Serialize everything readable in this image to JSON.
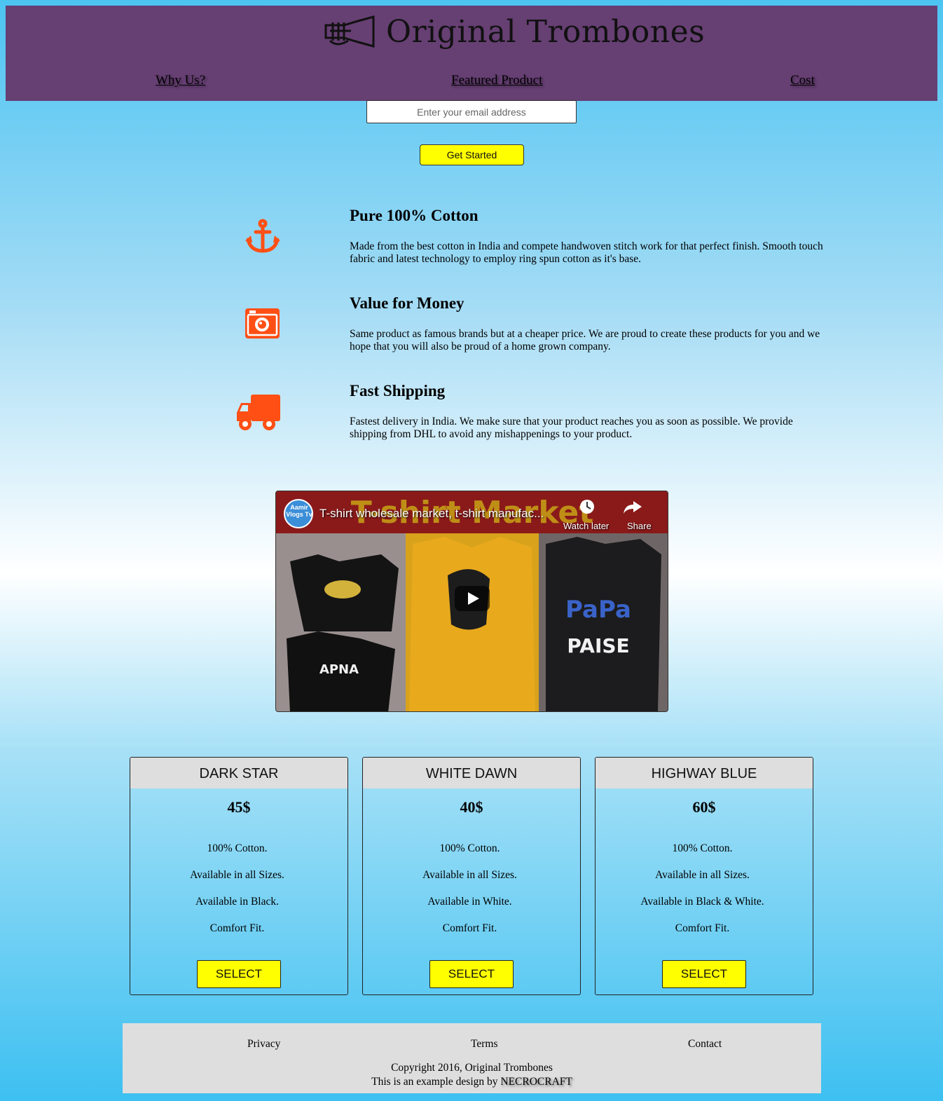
{
  "header": {
    "brand": "Original Trombones",
    "logo_icon": "trumpet-icon",
    "background_color": "#663f73",
    "nav": [
      {
        "label": "Why Us?"
      },
      {
        "label": "Featured Product"
      },
      {
        "label": "Cost"
      }
    ]
  },
  "signup": {
    "email_placeholder": "Enter your email address",
    "email_value": "",
    "button_label": "Get Started"
  },
  "features": [
    {
      "icon": "anchor-icon",
      "title": "Pure 100% Cotton",
      "text": "Made from the best cotton in India and compete handwoven stitch work for that perfect finish. Smooth touch fabric and latest technology to employ ring spun cotton as it's base."
    },
    {
      "icon": "camera-icon",
      "title": "Value for Money",
      "text": "Same product as famous brands but at a cheaper price. We are proud to create these products for you and we hope that you will also be proud of a home grown company."
    },
    {
      "icon": "truck-icon",
      "title": "Fast Shipping",
      "text": "Fastest delivery in India. We make sure that your product reaches you as soon as possible. We provide shipping from DHL to avoid any mishappenings to your product."
    }
  ],
  "video": {
    "title": "T-shirt wholesale market, t-shirt manufac...",
    "channel_badge": "Aamir Vlogs Tv",
    "watch_later": "Watch later",
    "share": "Share",
    "banner_text": "T-shirt Market"
  },
  "plans": [
    {
      "name": "DARK STAR",
      "price": "45$",
      "features": [
        "100% Cotton.",
        "Available in all Sizes.",
        "Available in Black.",
        "Comfort Fit."
      ],
      "button": "SELECT"
    },
    {
      "name": "WHITE DAWN",
      "price": "40$",
      "features": [
        "100% Cotton.",
        "Available in all Sizes.",
        "Available in White.",
        "Comfort Fit."
      ],
      "button": "SELECT"
    },
    {
      "name": "HIGHWAY BLUE",
      "price": "60$",
      "features": [
        "100% Cotton.",
        "Available in all Sizes.",
        "Available in Black & White.",
        "Comfort Fit."
      ],
      "button": "SELECT"
    }
  ],
  "footer": {
    "links": [
      {
        "label": "Privacy"
      },
      {
        "label": "Terms"
      },
      {
        "label": "Contact"
      }
    ],
    "copyright": "Copyright 2016, Original Trombones",
    "credit_prefix": "This is an example design by",
    "credit_name": "NECROCRAFT"
  },
  "colors": {
    "accent_icon": "#ff4f14",
    "button_yellow": "#ffff00"
  }
}
